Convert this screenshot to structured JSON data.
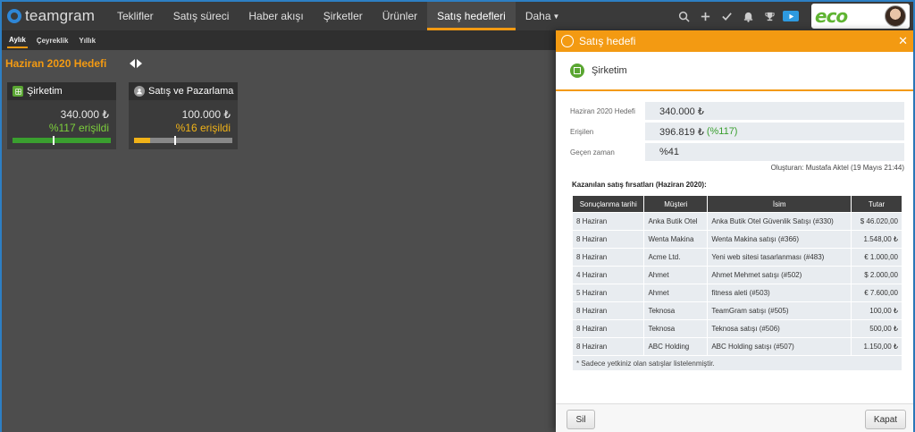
{
  "app": {
    "logo_text": "teamgram",
    "brand_logo": "eco"
  },
  "nav": {
    "items": [
      {
        "label": "Teklifler"
      },
      {
        "label": "Satış süreci"
      },
      {
        "label": "Haber akışı"
      },
      {
        "label": "Şirketler"
      },
      {
        "label": "Ürünler"
      },
      {
        "label": "Satış hedefleri"
      },
      {
        "label": "Daha"
      }
    ],
    "active_index": 5,
    "icons": [
      "search-icon",
      "plus-icon",
      "check-icon",
      "bell-icon",
      "trophy-icon",
      "video-icon"
    ]
  },
  "subtabs": [
    {
      "label": "Aylık"
    },
    {
      "label": "Çeyreklik"
    },
    {
      "label": "Yıllık"
    }
  ],
  "main": {
    "period_title": "Haziran 2020 Hedefi",
    "cards": [
      {
        "name": "Şirketim",
        "value": "340.000 ₺",
        "reached": "%117 erişildi",
        "progress": 1.0,
        "marker": 0.41
      },
      {
        "name": "Satış ve Pazarlama",
        "value": "100.000 ₺",
        "reached": "%16 erişildi",
        "progress": 0.16,
        "marker": 0.41
      }
    ]
  },
  "modal": {
    "title": "Satış hedefi",
    "company": "Şirketim",
    "fields": [
      {
        "label": "Haziran 2020 Hedefi",
        "value": "340.000 ₺",
        "extra": ""
      },
      {
        "label": "Erişilen",
        "value": "396.819 ₺",
        "extra": "(%117)"
      },
      {
        "label": "Geçen zaman",
        "value": "%41",
        "extra": ""
      }
    ],
    "created": "Oluşturan: Mustafa Aktel (19 Mayıs 21:44)",
    "section_title": "Kazanılan satış fırsatları (Haziran 2020):",
    "columns": [
      "Sonuçlanma tarihi",
      "Müşteri",
      "İsim",
      "Tutar"
    ],
    "rows": [
      [
        "8 Haziran",
        "Anka Butik Otel",
        "Anka Butik Otel Güvenlik Satışı (#330)",
        "$ 46.020,00"
      ],
      [
        "8 Haziran",
        "Wenta Makina",
        "Wenta Makina satışı (#366)",
        "1.548,00 ₺"
      ],
      [
        "8 Haziran",
        "Acme Ltd.",
        "Yeni web sitesi tasarlanması (#483)",
        "€ 1.000,00"
      ],
      [
        "4 Haziran",
        "Ahmet",
        "Ahmet Mehmet satışı (#502)",
        "$ 2.000,00"
      ],
      [
        "5 Haziran",
        "Ahmet",
        "fitness aleti (#503)",
        "€ 7.600,00"
      ],
      [
        "8 Haziran",
        "Teknosa",
        "TeamGram satışı (#505)",
        "100,00 ₺"
      ],
      [
        "8 Haziran",
        "Teknosa",
        "Teknosa satışı (#506)",
        "500,00 ₺"
      ],
      [
        "8 Haziran",
        "ABC Holding",
        "ABC Holding satışı (#507)",
        "1.150,00 ₺"
      ]
    ],
    "note": "* Sadece yetkiniz olan satışlar listelenmiştir.",
    "delete_label": "Sil",
    "close_label": "Kapat"
  }
}
